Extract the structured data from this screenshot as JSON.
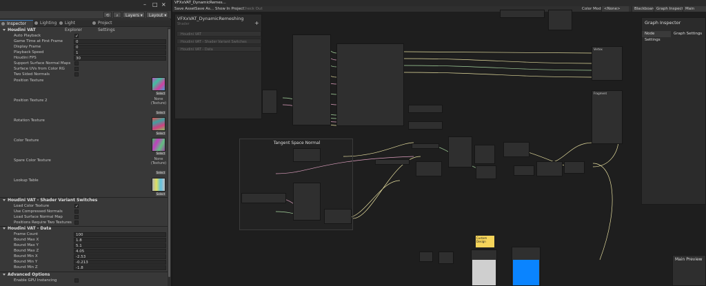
{
  "window": {
    "title": "VFXxVAT_DynamicRemes..."
  },
  "toolbar": {
    "layers": "Layers",
    "layout": "Layout"
  },
  "tabs": [
    {
      "label": "Inspector",
      "icon": "inspector-icon"
    },
    {
      "label": "Lighting",
      "icon": "lighting-icon"
    },
    {
      "label": "Light Explorer",
      "icon": "light-explorer-icon"
    },
    {
      "label": "Project Settings",
      "icon": "gear-icon"
    }
  ],
  "houdini_vat": {
    "header": "Houdini VAT",
    "auto_playback": "Auto Playback",
    "game_time_first": "Game Time at First Frame",
    "game_time_first_val": "0",
    "display_frame": "Display Frame",
    "display_frame_val": "0",
    "playback_speed": "Playback Speed",
    "playback_speed_val": "1",
    "houdini_fps": "Houdini FPS",
    "houdini_fps_val": "30",
    "support_normal": "Support Surface Normal Maps",
    "surface_uvs": "Surface UVs from Color RG",
    "two_sided": "Two Sided Normals",
    "position_texture": "Position Texture",
    "position_texture_2": "Position Texture 2",
    "rotation_texture": "Rotation Texture",
    "color_texture": "Color Texture",
    "spare_color_texture": "Spare Color Texture",
    "lookup_table": "Lookup Table",
    "none_texture": "None (Texture)",
    "select": "Select"
  },
  "shader_variants": {
    "header": "Houdini VAT - Shader Variant Switches",
    "load_color": "Load Color Texture",
    "use_compressed": "Use Compressed Normals",
    "load_surface": "Load Surface Normal Map",
    "positions_two": "Positions Require Two Textures"
  },
  "vat_data": {
    "header": "Houdini VAT - Data",
    "frame_count": "Frame Count",
    "frame_count_val": "100",
    "bound_max_x": "Bound Max X",
    "bound_max_x_val": "1.8",
    "bound_max_y": "Bound Max Y",
    "bound_max_y_val": "5.1",
    "bound_max_z": "Bound Max Z",
    "bound_max_z_val": "4.05",
    "bound_min_x": "Bound Min X",
    "bound_min_x_val": "-2.53",
    "bound_min_y": "Bound Min Y",
    "bound_min_y_val": "-0.213",
    "bound_min_z": "Bound Min Z",
    "bound_min_z_val": "-1.8"
  },
  "advanced": {
    "header": "Advanced Options",
    "gpu_instancing": "Enable GPU Instancing"
  },
  "graph_menu": {
    "save_asset": "Save Asset",
    "save_as": "Save As...",
    "show_in_project": "Show In Project",
    "check_out": "Check Out",
    "color_mode": "Color Mode",
    "color_mode_val": "<None>",
    "blackboard": "Blackboard",
    "graph_inspector": "Graph Inspector",
    "main_preview": "Main Preview"
  },
  "blackboard_panel": {
    "title": "VFXxVAT_DynamicRemeshing",
    "subtitle": "Shader",
    "items": [
      "Houdini VAT",
      "Houdini VAT - Shader Variant Switches",
      "Houdini VAT - Data"
    ]
  },
  "graph_inspector_panel": {
    "title": "Graph Inspector",
    "node_settings": "Node Settings",
    "graph_settings": "Graph Settings"
  },
  "main_preview_panel": {
    "title": "Main Preview"
  },
  "group_title": "Tangent Space Normal",
  "nodes": {
    "vertex": "Vertex",
    "fragment": "Fragment",
    "custom_design": "Custom Design"
  },
  "colors": {
    "accent": "#3a79bb",
    "wire_green": "#a8d8a0",
    "wire_pink": "#e0a0c0",
    "wire_yellow": "#e8e0a0",
    "preview_blue": "#0a84ff",
    "sticky": "#f5d45a"
  }
}
